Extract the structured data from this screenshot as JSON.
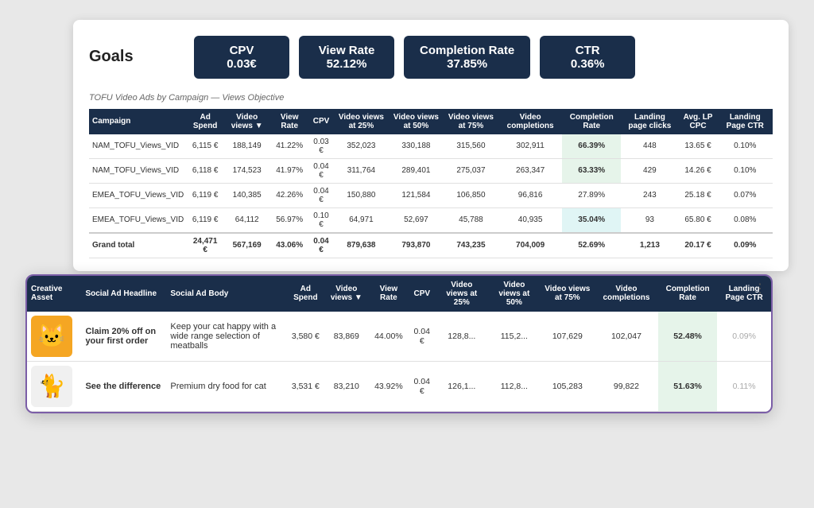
{
  "goals": {
    "title": "Goals",
    "metrics": [
      {
        "label": "CPV",
        "value": "0.03€"
      },
      {
        "label": "View Rate",
        "value": "52.12%"
      },
      {
        "label": "Completion Rate",
        "value": "37.85%"
      },
      {
        "label": "CTR",
        "value": "0.36%"
      }
    ]
  },
  "upper_table": {
    "subtitle": "TOFU Video Ads by Campaign — Views Objective",
    "columns": [
      "Campaign",
      "Ad Spend",
      "Video views ▼",
      "View Rate",
      "CPV",
      "Video views at 25%",
      "Video views at 50%",
      "Video views at 75%",
      "Video completions",
      "Completion Rate",
      "Landing page clicks",
      "Avg. LP CPC",
      "Landing Page CTR"
    ],
    "rows": [
      {
        "campaign": "NAM_TOFU_Views_VID",
        "ad_spend": "6,115 €",
        "video_views": "188,149",
        "view_rate": "41.22%",
        "cpv": "0.03 €",
        "views_25": "352,023",
        "views_50": "330,188",
        "views_75": "315,560",
        "completions": "302,911",
        "completion_rate": "66.39%",
        "lp_clicks": "448",
        "avg_lp_cpc": "13.65 €",
        "lp_ctr": "0.10%",
        "highlight": "green"
      },
      {
        "campaign": "NAM_TOFU_Views_VID",
        "ad_spend": "6,118 €",
        "video_views": "174,523",
        "view_rate": "41.97%",
        "cpv": "0.04 €",
        "views_25": "311,764",
        "views_50": "289,401",
        "views_75": "275,037",
        "completions": "263,347",
        "completion_rate": "63.33%",
        "lp_clicks": "429",
        "avg_lp_cpc": "14.26 €",
        "lp_ctr": "0.10%",
        "highlight": "green"
      },
      {
        "campaign": "EMEA_TOFU_Views_VID",
        "ad_spend": "6,119 €",
        "video_views": "140,385",
        "view_rate": "42.26%",
        "cpv": "0.04 €",
        "views_25": "150,880",
        "views_50": "121,584",
        "views_75": "106,850",
        "completions": "96,816",
        "completion_rate": "27.89%",
        "lp_clicks": "243",
        "avg_lp_cpc": "25.18 €",
        "lp_ctr": "0.07%",
        "highlight": "none"
      },
      {
        "campaign": "EMEA_TOFU_Views_VID",
        "ad_spend": "6,119 €",
        "video_views": "64,112",
        "view_rate": "56.97%",
        "cpv": "0.10 €",
        "views_25": "64,971",
        "views_50": "52,697",
        "views_75": "45,788",
        "completions": "40,935",
        "completion_rate": "35.04%",
        "lp_clicks": "93",
        "avg_lp_cpc": "65.80 €",
        "lp_ctr": "0.08%",
        "highlight": "teal"
      },
      {
        "campaign": "Grand total",
        "ad_spend": "24,471 €",
        "video_views": "567,169",
        "view_rate": "43.06%",
        "cpv": "0.04 €",
        "views_25": "879,638",
        "views_50": "793,870",
        "views_75": "743,235",
        "completions": "704,009",
        "completion_rate": "52.69%",
        "lp_clicks": "1,213",
        "avg_lp_cpc": "20.17 €",
        "lp_ctr": "0.09%",
        "highlight": "none"
      }
    ]
  },
  "lower_table": {
    "columns": [
      "Creative Asset",
      "Social Ad Headline",
      "Social Ad Body",
      "Ad Spend",
      "Video views ▼",
      "View Rate",
      "CPV",
      "Video views at 25%",
      "Video views at 50%",
      "Video views at 75%",
      "Video completions",
      "Completion Rate",
      "Landing Page CTR"
    ],
    "rows": [
      {
        "asset_emoji": "🐱",
        "asset_bg": "#f5a623",
        "headline": "Claim 20% off on your first order",
        "body": "Keep your cat happy with a wide range selection of meatballs",
        "ad_spend": "3,580 €",
        "video_views": "83,869",
        "view_rate": "44.00%",
        "cpv": "0.04 €",
        "views_25": "128,8...",
        "views_50": "115,2...",
        "views_75": "107,629",
        "completions": "102,047",
        "completion_rate": "52.48%",
        "lp_ctr": "0.09%"
      },
      {
        "asset_emoji": "🐈",
        "asset_bg": "#f0f0f0",
        "headline": "See the difference",
        "body": "Premium dry food for cat",
        "ad_spend": "3,531 €",
        "video_views": "83,210",
        "view_rate": "43.92%",
        "cpv": "0.04 €",
        "views_25": "126,1...",
        "views_50": "112,8...",
        "views_75": "105,283",
        "completions": "99,822",
        "completion_rate": "51.63%",
        "lp_ctr": "0.11%"
      }
    ]
  }
}
